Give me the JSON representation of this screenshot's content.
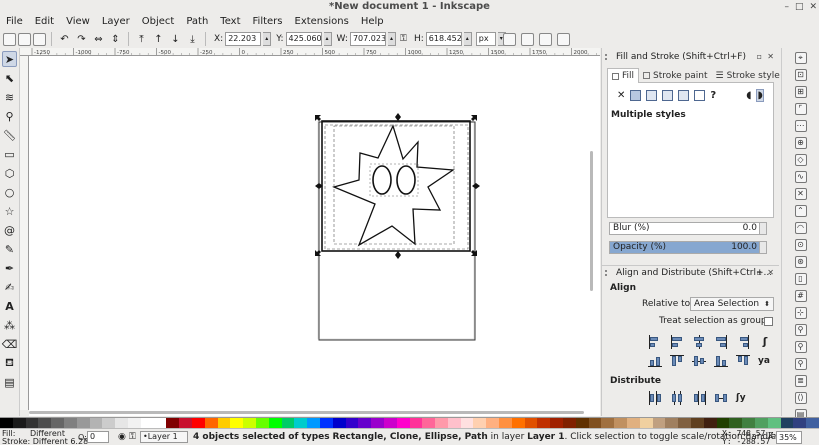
{
  "window": {
    "title": "*New document 1 - Inkscape"
  },
  "menu": [
    "File",
    "Edit",
    "View",
    "Layer",
    "Object",
    "Path",
    "Text",
    "Filters",
    "Extensions",
    "Help"
  ],
  "toolbar": {
    "x_label": "X:",
    "x_value": "22.203",
    "y_label": "Y:",
    "y_value": "425.060",
    "w_label": "W:",
    "w_value": "707.023",
    "h_label": "H:",
    "h_value": "618.452",
    "unit": "px"
  },
  "ruler": {
    "ticks": [
      "-1250",
      "-1000",
      "-750",
      "-500",
      "-250",
      "0",
      "250",
      "500",
      "750",
      "1000",
      "1250",
      "1500",
      "1750",
      "2000"
    ]
  },
  "fill_stroke": {
    "title": "Fill and Stroke (Shift+Ctrl+F)",
    "tabs": [
      "Fill",
      "Stroke paint",
      "Stroke style"
    ],
    "paint_unknown": "?",
    "message": "Multiple styles",
    "blur_label": "Blur (%)",
    "blur_value": "0.0",
    "opacity_label": "Opacity (%)",
    "opacity_value": "100.0",
    "opacity_level": 1.0
  },
  "align": {
    "title": "Align and Distribute (Shift+Ctrl+...",
    "align_label": "Align",
    "relative_to_label": "Relative to:",
    "relative_to_value": "Area Selection",
    "treat_group_label": "Treat selection as group:",
    "treat_group_checked": false,
    "distribute_label": "Distribute"
  },
  "status": {
    "fill_label": "Fill:",
    "fill_value": "Different",
    "stroke_label": "Stroke:",
    "stroke_value": "Different",
    "stroke_width": "6.28",
    "opacity_label": "O:",
    "opacity_value": "0",
    "layer": "•Layer 1",
    "msg_count": "4 objects selected of types",
    "msg_types": "Rectangle, Clone, Ellipse, Path",
    "msg_in_layer": "in layer",
    "msg_layer": "Layer 1",
    "msg_hint": ". Click selection to toggle scale/rotation handles.",
    "x_label": "X:",
    "x_value": "748.57",
    "y_label": "Y:",
    "y_value": "-288.57",
    "zoom_label": "Z:",
    "zoom_value": "35%"
  },
  "palette": [
    "#000000",
    "#1a1a1a",
    "#333333",
    "#4d4d4d",
    "#666666",
    "#808080",
    "#999999",
    "#b3b3b3",
    "#cccccc",
    "#e6e6e6",
    "#f2f2f2",
    "#ffffff",
    "#ffffff",
    "#800000",
    "#c8102e",
    "#ff0000",
    "#ff6600",
    "#ffcc00",
    "#ffff00",
    "#ccff00",
    "#66ff00",
    "#00ff00",
    "#00cc66",
    "#00cccc",
    "#0099ff",
    "#0033ff",
    "#0000cc",
    "#3300cc",
    "#6600cc",
    "#9900cc",
    "#cc00cc",
    "#ff00cc",
    "#ff3399",
    "#ff6699",
    "#ff99aa",
    "#ffc0cb",
    "#ffe0e0",
    "#ffd0b0",
    "#ffb080",
    "#ff9040",
    "#ff7000",
    "#e05000",
    "#c03000",
    "#a02000",
    "#802000",
    "#603000",
    "#805020",
    "#a07040",
    "#c09060",
    "#e0b080",
    "#f0d0a0",
    "#c0a080",
    "#a08060",
    "#806040",
    "#604020",
    "#402010",
    "#204000",
    "#306020",
    "#408040",
    "#50a060",
    "#60c080",
    "#204060",
    "#304080",
    "#4060a0"
  ]
}
